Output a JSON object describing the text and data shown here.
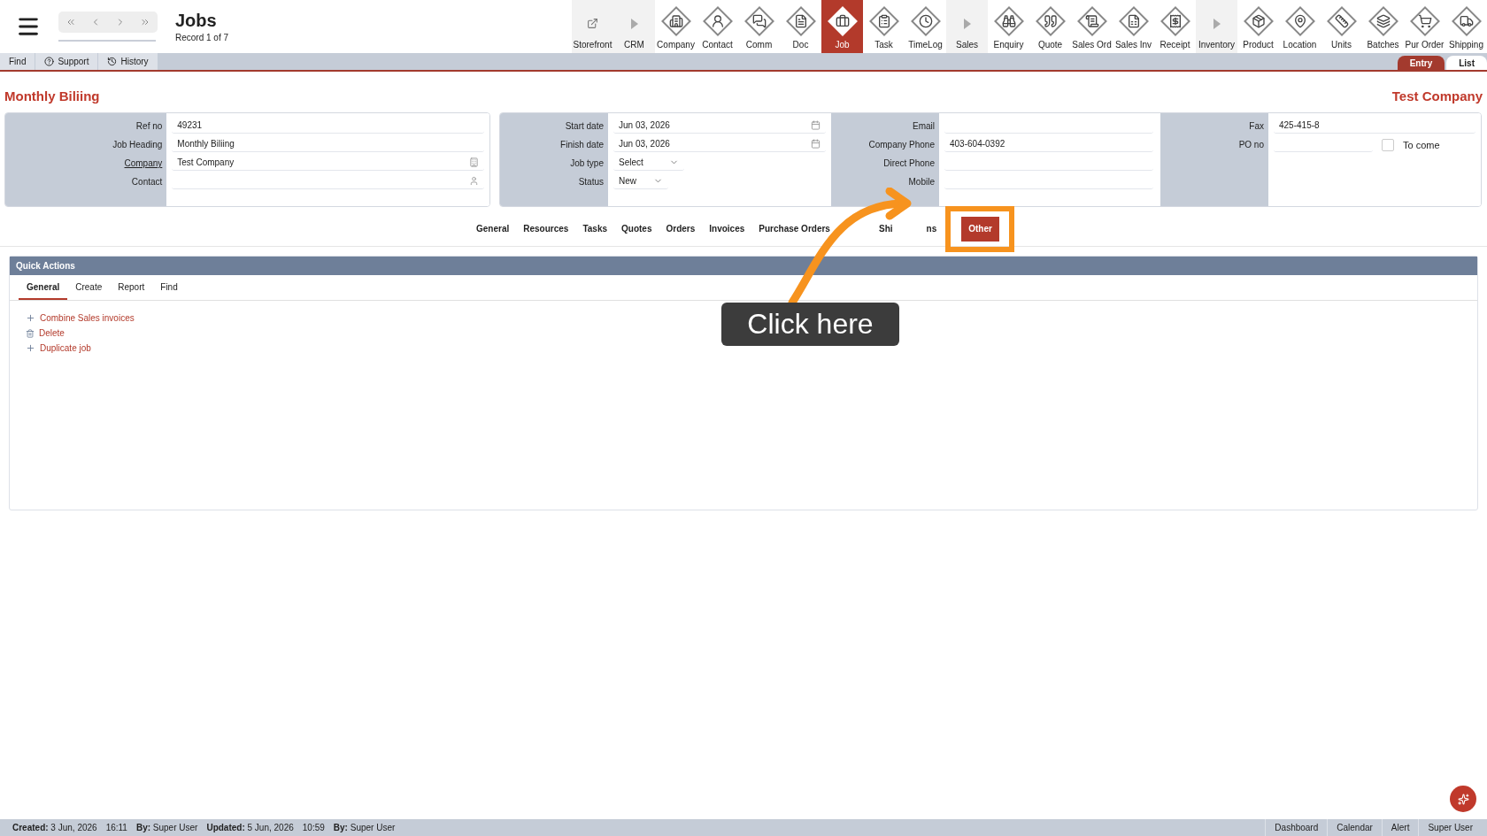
{
  "header": {
    "title": "Jobs",
    "record": "Record 1 of 7"
  },
  "modules": [
    {
      "label": "Storefront",
      "kind": "link",
      "selected": false
    },
    {
      "label": "CRM",
      "kind": "section",
      "selected": false
    },
    {
      "label": "Company",
      "kind": "module",
      "selected": false
    },
    {
      "label": "Contact",
      "kind": "module",
      "selected": false
    },
    {
      "label": "Comm",
      "kind": "module",
      "selected": false
    },
    {
      "label": "Doc",
      "kind": "module",
      "selected": false
    },
    {
      "label": "Job",
      "kind": "module",
      "selected": true
    },
    {
      "label": "Task",
      "kind": "module",
      "selected": false
    },
    {
      "label": "TimeLog",
      "kind": "module",
      "selected": false
    },
    {
      "label": "Sales",
      "kind": "section",
      "selected": false
    },
    {
      "label": "Enquiry",
      "kind": "module",
      "selected": false
    },
    {
      "label": "Quote",
      "kind": "module",
      "selected": false
    },
    {
      "label": "Sales Ord",
      "kind": "module",
      "selected": false
    },
    {
      "label": "Sales Inv",
      "kind": "module",
      "selected": false
    },
    {
      "label": "Receipt",
      "kind": "module",
      "selected": false
    },
    {
      "label": "Inventory",
      "kind": "section",
      "selected": false
    },
    {
      "label": "Product",
      "kind": "module",
      "selected": false
    },
    {
      "label": "Location",
      "kind": "module",
      "selected": false
    },
    {
      "label": "Units",
      "kind": "module",
      "selected": false
    },
    {
      "label": "Batches",
      "kind": "module",
      "selected": false
    },
    {
      "label": "Pur Order",
      "kind": "module",
      "selected": false
    },
    {
      "label": "Shipping",
      "kind": "module",
      "selected": false
    }
  ],
  "actions": [
    {
      "label": "Find",
      "kind": "plain"
    },
    {
      "label": "Support",
      "kind": "help"
    },
    {
      "label": "History",
      "kind": "history"
    }
  ],
  "view_tabs": [
    {
      "label": "Entry",
      "selected": true
    },
    {
      "label": "List",
      "selected": false
    }
  ],
  "record_title": "Monthly Biliing",
  "company_title": "Test Company",
  "form_left": [
    {
      "label": "Ref no",
      "value": "49231",
      "kind": "text",
      "link": false
    },
    {
      "label": "Job Heading",
      "value": "Monthly Biliing",
      "kind": "text",
      "link": false
    },
    {
      "label": "Company",
      "value": "Test Company",
      "kind": "company",
      "link": true
    },
    {
      "label": "Contact",
      "kind": "contact",
      "link": false
    }
  ],
  "form_dates": [
    {
      "label": "Start date",
      "value": "Jun 03, 2026",
      "kind": "date"
    },
    {
      "label": "Finish date",
      "value": "Jun 03, 2026",
      "kind": "date"
    },
    {
      "label": "Job type",
      "value": "Select",
      "kind": "select"
    },
    {
      "label": "Status",
      "value": "New",
      "kind": "select"
    }
  ],
  "form_contact": [
    {
      "label": "Email"
    },
    {
      "label": "Company Phone",
      "value": "403-604-0392"
    },
    {
      "label": "Direct Phone"
    },
    {
      "label": "Mobile"
    }
  ],
  "form_other": {
    "fax_label": "Fax",
    "fax": "425-415-8",
    "po_label": "PO no",
    "to_come": {
      "label": "To come",
      "checked": false
    }
  },
  "record_tabs": [
    {
      "label": "General",
      "selected": false
    },
    {
      "label": "Resources",
      "selected": false
    },
    {
      "label": "Tasks",
      "selected": false
    },
    {
      "label": "Quotes",
      "selected": false
    },
    {
      "label": "Orders",
      "selected": false
    },
    {
      "label": "Invoices",
      "selected": false
    },
    {
      "label": "Purchase Orders",
      "selected": false
    },
    {
      "label": "Shi",
      "selected": false
    },
    {
      "label": "ns",
      "selected": false
    },
    {
      "label": "Other",
      "selected": true
    }
  ],
  "quick_actions": {
    "title": "Quick Actions",
    "tabs": [
      {
        "label": "General",
        "selected": true
      },
      {
        "label": "Create",
        "selected": false
      },
      {
        "label": "Report",
        "selected": false
      },
      {
        "label": "Find",
        "selected": false
      }
    ],
    "items": [
      {
        "label": "Combine Sales invoices",
        "kind": "add"
      },
      {
        "label": "Delete",
        "kind": "delete"
      },
      {
        "label": "Duplicate job",
        "kind": "add"
      }
    ]
  },
  "annotation": {
    "callout": "Click here"
  },
  "status_bar": {
    "left": [
      {
        "label": "Created:",
        "value": "3 Jun, 2026"
      },
      {
        "value": "16:11"
      },
      {
        "label": "By:",
        "value": "Super User"
      },
      {
        "label": "Updated:",
        "value": "5 Jun, 2026"
      },
      {
        "value": "10:59"
      },
      {
        "label": "By:",
        "value": "Super User"
      }
    ],
    "right": [
      "Dashboard",
      "Calendar",
      "Alert",
      "Super User"
    ]
  }
}
